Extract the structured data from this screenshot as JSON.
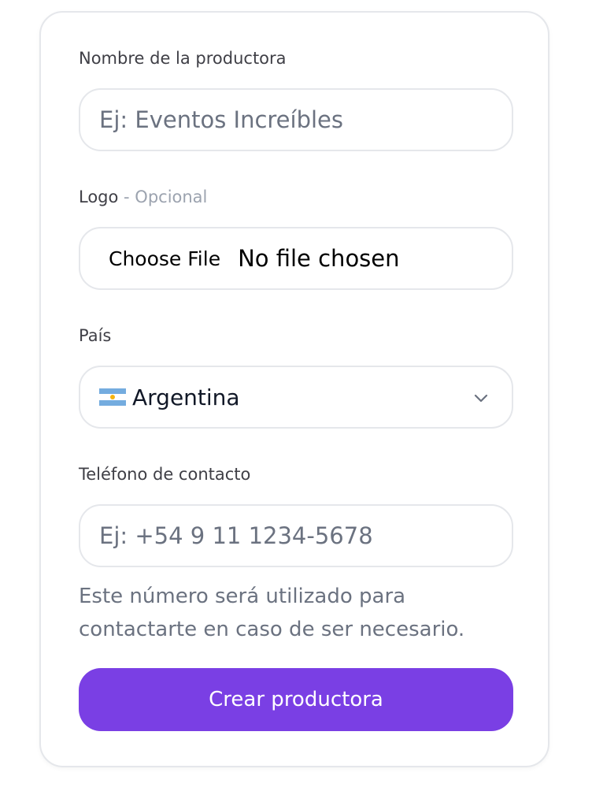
{
  "form": {
    "name_field": {
      "label": "Nombre de la productora",
      "placeholder": "Ej: Eventos Increíbles",
      "value": ""
    },
    "logo_field": {
      "label": "Logo",
      "optional_suffix": " - Opcional",
      "button_label": "Choose File",
      "status": "No file chosen"
    },
    "country_field": {
      "label": "País",
      "selected": "Argentina",
      "flag_icon": "argentina-flag-icon",
      "flag_colors": {
        "blue": "#74acdf",
        "white": "#ffffff",
        "sun": "#f6b40e"
      }
    },
    "phone_field": {
      "label": "Teléfono de contacto",
      "placeholder": "Ej: +54 9 11 1234-5678",
      "value": "",
      "helper": "Este número será utilizado para contactarte en caso de ser necesario."
    },
    "submit_label": "Crear productora"
  },
  "colors": {
    "accent": "#7a3fe4",
    "border": "#e5e7eb",
    "label": "#3f3f46",
    "muted": "#6b7280"
  }
}
